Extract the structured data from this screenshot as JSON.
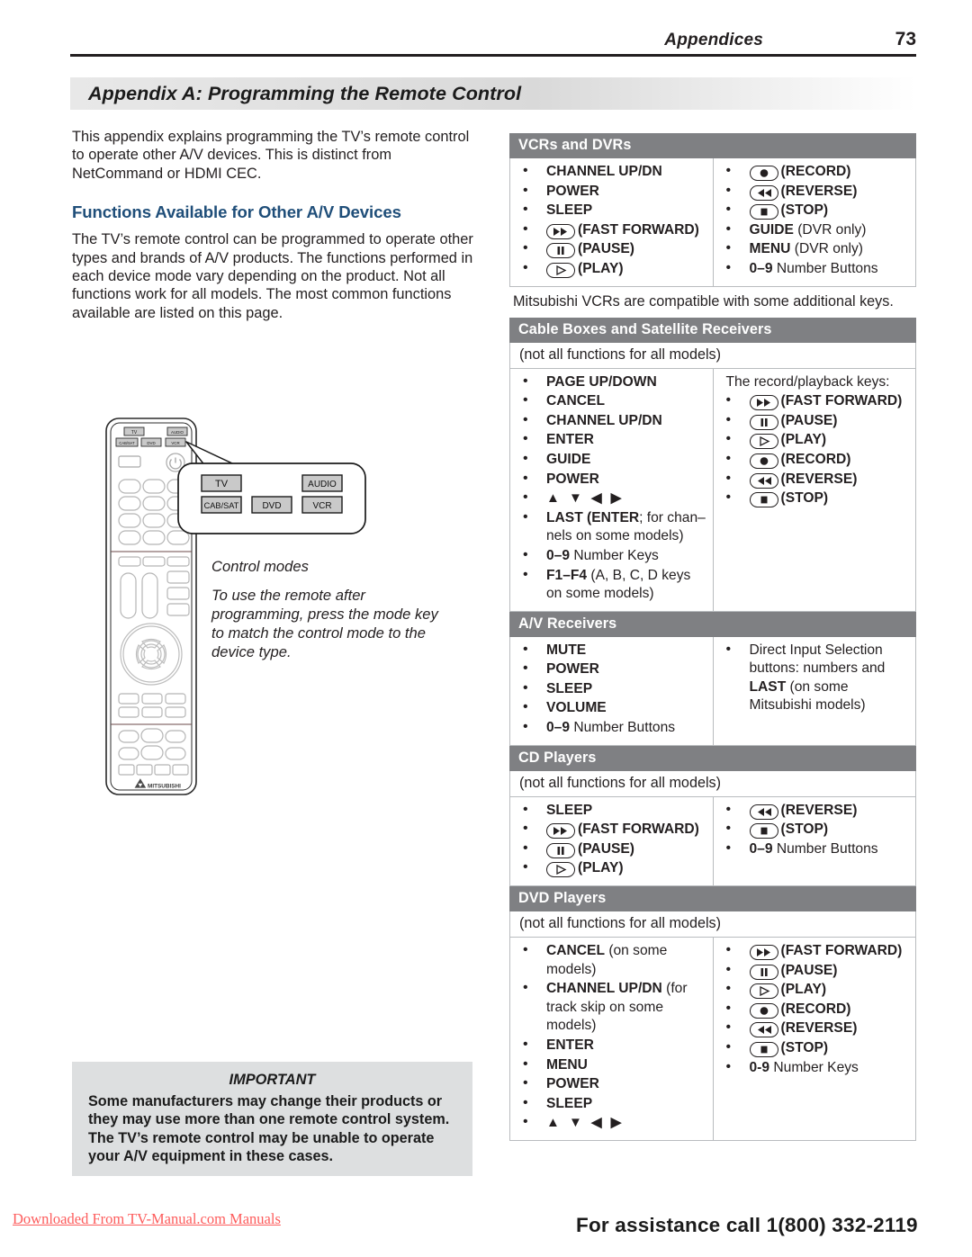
{
  "header": {
    "section": "Appendices",
    "page_number": "73"
  },
  "appendix": {
    "title": "Appendix A:  Programming the Remote Control"
  },
  "intro": {
    "paragraph": "This appendix explains programming the TV’s remote control to operate other A/V devices.  This is distinct from NetCommand or HDMI CEC.",
    "section_heading": "Functions Available for Other A/V Devices",
    "body": "The TV’s remote control can be programmed to operate other types and brands of A/V products. The functions performed in each device mode vary depending on the product.  Not all functions work for all models. The most common functions available are listed on this page."
  },
  "remote_figure": {
    "callout_buttons": [
      "TV",
      "AUDIO",
      "CAB/SAT",
      "DVD",
      "VCR"
    ],
    "remote_top_buttons": [
      "TV",
      "AUDIO",
      "CAB/SAT",
      "DVD",
      "VCR"
    ],
    "brand": "MITSUBISHI",
    "caption_title": "Control modes",
    "caption_body": "To use the remote after programming, press the mode key to match the control mode to the device type."
  },
  "tables": [
    {
      "id": "vcrs-and-dvrs",
      "title": "VCRs and DVRs",
      "subtitle": null,
      "left": [
        {
          "bold": "CHANNEL UP/DN"
        },
        {
          "bold": "POWER"
        },
        {
          "bold": "SLEEP"
        },
        {
          "icon": "fast-forward",
          "bold": "(FAST FORWARD)"
        },
        {
          "icon": "pause",
          "bold": "(PAUSE)"
        },
        {
          "icon": "play",
          "bold": "(PLAY)"
        }
      ],
      "right": [
        {
          "icon": "record",
          "bold": "(RECORD)"
        },
        {
          "icon": "reverse",
          "bold": "(REVERSE)"
        },
        {
          "icon": "stop",
          "bold": "(STOP)"
        },
        {
          "bold": "GUIDE",
          "plain": " (DVR only)"
        },
        {
          "bold": "MENU",
          "plain": " (DVR only)"
        },
        {
          "bold": "0–9",
          "plain": " Number Buttons"
        }
      ],
      "note": "Mitsubishi VCRs are compatible with some additional keys."
    },
    {
      "id": "cable-boxes-and-satellite-receivers",
      "title": "Cable Boxes and Satellite Receivers",
      "subtitle": "(not all functions for all models)",
      "left": [
        {
          "bold": "PAGE UP/DOWN"
        },
        {
          "bold": "CANCEL"
        },
        {
          "bold": "CHANNEL UP/DN"
        },
        {
          "bold": "ENTER"
        },
        {
          "bold": "GUIDE"
        },
        {
          "bold": "POWER"
        },
        {
          "arrows": "▲ ▼ ◀ ▶"
        },
        {
          "bold": "LAST (",
          "bold2": "ENTER",
          "plain": "; for chan–nels on some models)"
        },
        {
          "bold": "0–9",
          "plain": " Number Keys"
        },
        {
          "bold": "F1–F4",
          "plain": " (A, B, C, D keys on some models)"
        }
      ],
      "right_lead": "The record/playback keys:",
      "right": [
        {
          "icon": "fast-forward",
          "bold": "(FAST FORWARD)"
        },
        {
          "icon": "pause",
          "bold": "(PAUSE)"
        },
        {
          "icon": "play",
          "bold": "(PLAY)"
        },
        {
          "icon": "record",
          "bold": "(RECORD)"
        },
        {
          "icon": "reverse",
          "bold": "(REVERSE)"
        },
        {
          "icon": "stop",
          "bold": "(STOP)"
        }
      ],
      "note": null
    },
    {
      "id": "av-receivers",
      "title": "A/V Receivers",
      "subtitle": null,
      "left": [
        {
          "bold": "MUTE"
        },
        {
          "bold": "POWER"
        },
        {
          "bold": "SLEEP"
        },
        {
          "bold": "VOLUME"
        },
        {
          "bold": "0–9",
          "plain": " Number Buttons"
        }
      ],
      "right": [
        {
          "plain_lead": "Direct Input Selection buttons:  numbers and ",
          "bold": "LAST",
          "plain": " (on some Mitsubishi models)"
        }
      ],
      "note": null
    },
    {
      "id": "cd-players",
      "title": "CD Players",
      "subtitle": "(not all functions for all models)",
      "left": [
        {
          "bold": "SLEEP"
        },
        {
          "icon": "fast-forward",
          "bold": "(FAST FORWARD)"
        },
        {
          "icon": "pause",
          "bold": "(PAUSE)"
        },
        {
          "icon": "play",
          "bold": "(PLAY)"
        }
      ],
      "right": [
        {
          "icon": "reverse",
          "bold": "(REVERSE)"
        },
        {
          "icon": "stop",
          "bold": "(STOP)"
        },
        {
          "bold": "0–9",
          "plain": " Number Buttons"
        }
      ],
      "note": null
    },
    {
      "id": "dvd-players",
      "title": "DVD Players",
      "subtitle": "(not all functions for all models)",
      "left": [
        {
          "bold": "CANCEL",
          "plain": " (on some models)"
        },
        {
          "bold": "CHANNEL UP/DN",
          "plain": " (for track skip on some models)"
        },
        {
          "bold": "ENTER"
        },
        {
          "bold": "MENU"
        },
        {
          "bold": "POWER"
        },
        {
          "bold": "SLEEP"
        },
        {
          "arrows": "▲ ▼ ◀ ▶"
        }
      ],
      "right": [
        {
          "icon": "fast-forward",
          "bold": "(FAST FORWARD)"
        },
        {
          "icon": "pause",
          "bold": "(PAUSE)"
        },
        {
          "icon": "play",
          "bold": "(PLAY)"
        },
        {
          "icon": "record",
          "bold": "(RECORD)"
        },
        {
          "icon": "reverse",
          "bold": "(REVERSE)"
        },
        {
          "icon": "stop",
          "bold": "(STOP)"
        },
        {
          "bold": "0-9",
          "plain": " Number Keys"
        }
      ],
      "note": null
    }
  ],
  "important": {
    "title": "IMPORTANT",
    "text": "Some manufacturers may change their products or they may use more than one remote control system.  The TV’s remote control may be unable to operate your A/V equipment in these cases."
  },
  "footer": {
    "watermark": "Downloaded From TV-Manual.com Manuals",
    "assistance": "For assistance call 1(800) 332-2119"
  },
  "colors": {
    "heading_blue": "#1f4e79",
    "table_header_gray": "#7f8083",
    "important_bg": "#dddfe0",
    "watermark_red": "#fd5c5c"
  }
}
